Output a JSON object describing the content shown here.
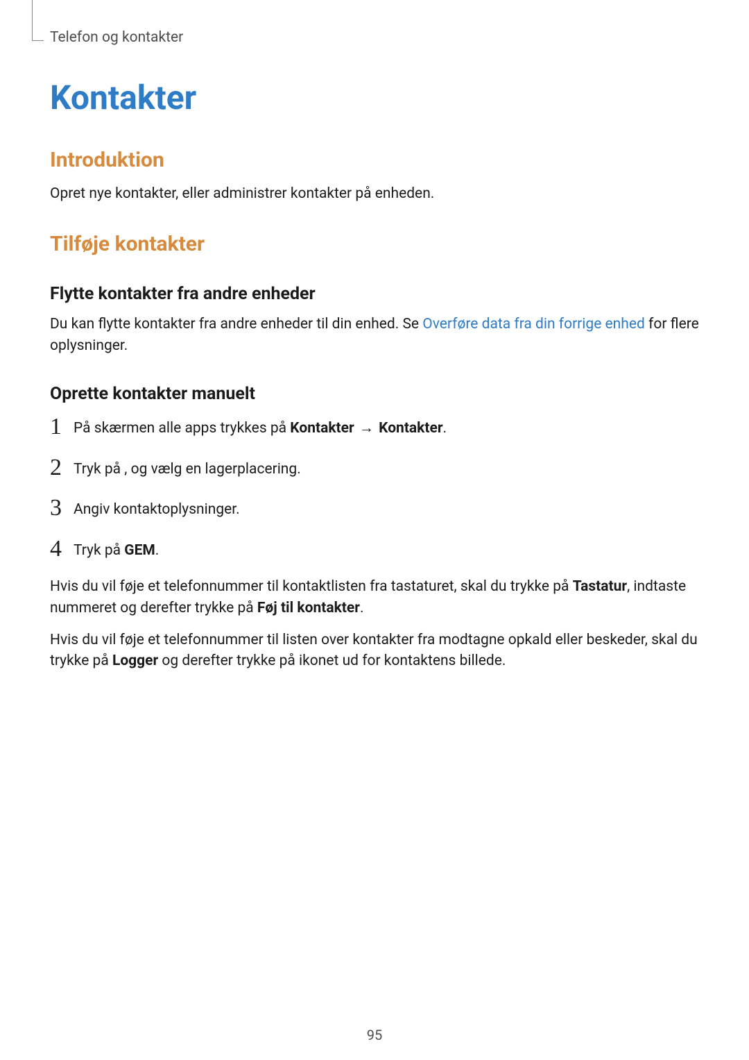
{
  "breadcrumb": "Telefon og kontakter",
  "h1": "Kontakter",
  "intro": {
    "heading": "Introduktion",
    "text": "Opret nye kontakter, eller administrer kontakter på enheden."
  },
  "add": {
    "heading": "Tilføje kontakter",
    "move": {
      "heading": "Flytte kontakter fra andre enheder",
      "text_pre": "Du kan flytte kontakter fra andre enheder til din enhed. Se ",
      "link": "Overføre data fra din forrige enhed",
      "text_post": " for flere oplysninger."
    },
    "manual": {
      "heading": "Oprette kontakter manuelt",
      "steps": [
        {
          "num": "1",
          "pre": "På skærmen alle apps trykkes på  ",
          "bold1": "Kontakter",
          "arrow": " → ",
          "bold2": "Kontakter",
          "post": "."
        },
        {
          "num": "2",
          "pre": "Tryk på      , og vælg en lagerplacering."
        },
        {
          "num": "3",
          "pre": "Angiv kontaktoplysninger."
        },
        {
          "num": "4",
          "pre": "Tryk på ",
          "bold1": "GEM",
          "post": "."
        }
      ],
      "para1_pre": "Hvis du vil føje et telefonnummer til kontaktlisten fra tastaturet, skal du trykke på ",
      "para1_b1": "Tastatur",
      "para1_mid": ", indtaste nummeret og derefter trykke på ",
      "para1_b2": "Føj til kontakter",
      "para1_post": ".",
      "para2_pre": "Hvis du vil føje et telefonnummer til listen over kontakter fra modtagne opkald eller beskeder, skal du trykke på ",
      "para2_b1": "Logger",
      "para2_post": " og derefter trykke på ikonet ud for kontaktens billede."
    }
  },
  "page_number": "95"
}
